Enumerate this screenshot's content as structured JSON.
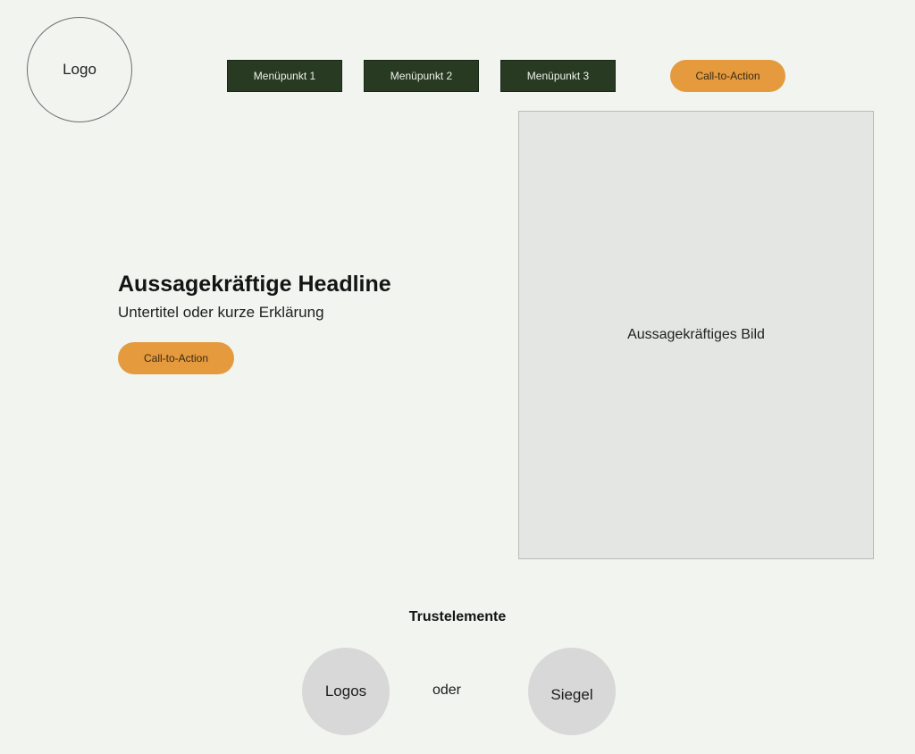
{
  "header": {
    "logo_label": "Logo",
    "menu": [
      {
        "label": "Menüpunkt 1"
      },
      {
        "label": "Menüpunkt 2"
      },
      {
        "label": "Menüpunkt 3"
      }
    ],
    "cta_label": "Call-to-Action"
  },
  "hero": {
    "headline": "Aussagekräftige Headline",
    "subtitle": "Untertitel oder kurze Erklärung",
    "cta_label": "Call-to-Action",
    "image_label": "Aussagekräftiges Bild"
  },
  "trust": {
    "title": "Trustelemente",
    "logos_label": "Logos",
    "or_label": "oder",
    "siegel_label": "Siegel"
  },
  "colors": {
    "background": "#f1f4ef",
    "menu_bg": "#283a22",
    "cta_bg": "#e49a3d",
    "image_placeholder": "#e4e6e3",
    "trust_circle": "#d8d8d8"
  }
}
